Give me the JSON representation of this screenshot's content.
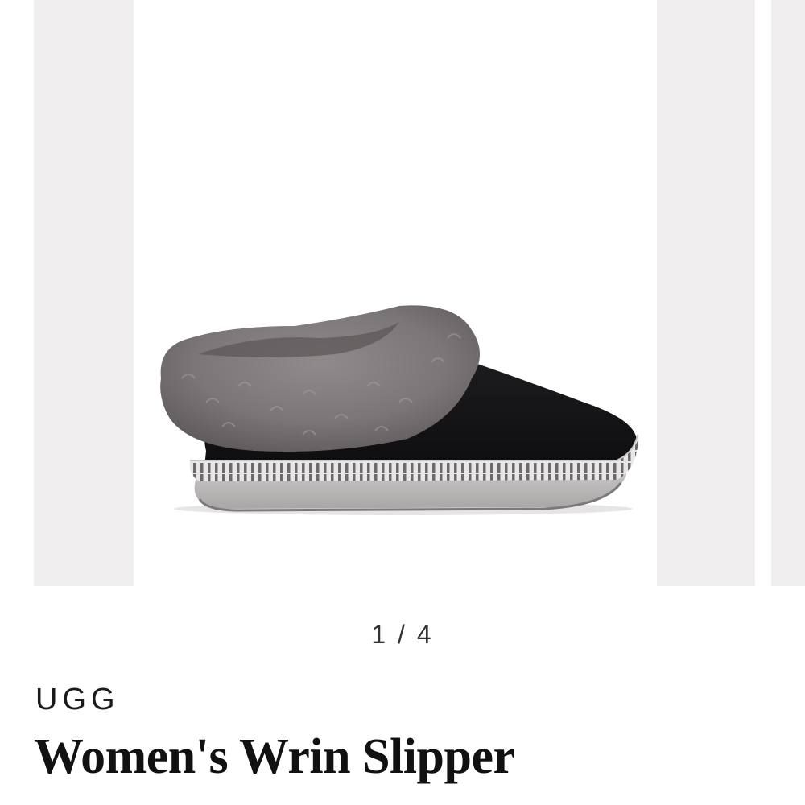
{
  "carousel": {
    "counter_current": "1",
    "counter_total": "4",
    "counter_text": "1 / 4",
    "image_alt": "Women's Wrin Slipper",
    "background_color": "#f0eeef"
  },
  "product": {
    "brand": "UGG",
    "title": "Women's Wrin Slipper"
  }
}
